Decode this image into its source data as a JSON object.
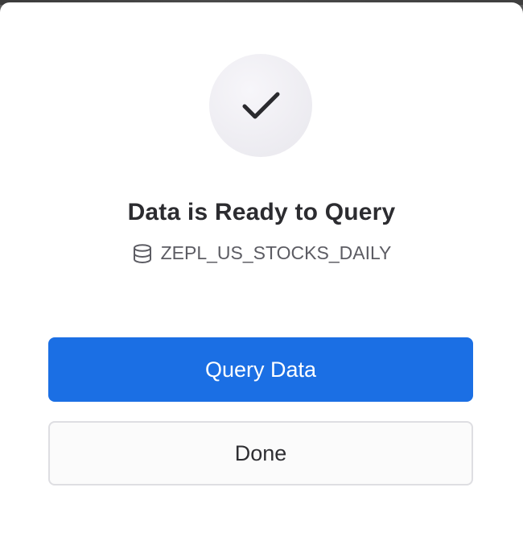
{
  "dialog": {
    "title": "Data is Ready to Query",
    "dataset_name": "ZEPL_US_STOCKS_DAILY",
    "success_icon": "checkmark-icon",
    "dataset_icon": "database-icon"
  },
  "actions": {
    "primary_label": "Query Data",
    "secondary_label": "Done"
  },
  "colors": {
    "primary": "#1b6fe4",
    "title_text": "#2c2c30",
    "muted_text": "#5c5c63",
    "circle_bg": "#eeedf2"
  }
}
